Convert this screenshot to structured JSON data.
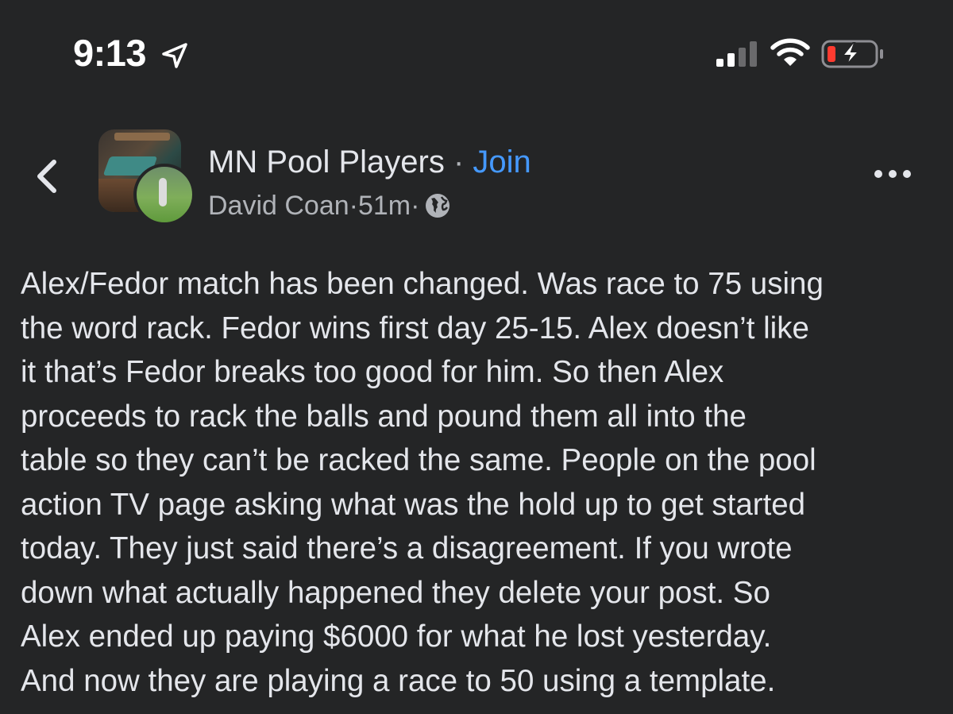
{
  "status_bar": {
    "time": "9:13",
    "location_icon": "location-arrow-icon",
    "signal_icon": "cellular-signal-icon",
    "wifi_icon": "wifi-icon",
    "battery_icon": "battery-charging-icon",
    "battery_level_percent": 15
  },
  "header": {
    "back_icon": "chevron-left-icon",
    "group_name": "MN Pool Players",
    "separator": " · ",
    "join_label": "Join",
    "author": "David Coan",
    "time_ago": "51m",
    "privacy_icon": "globe-icon",
    "more_icon": "more-dots-icon"
  },
  "post": {
    "lines": [
      "Alex/Fedor match has been changed. Was race to 75 using",
      "the word rack. Fedor wins first day 25-15. Alex doesn’t like",
      "it that’s Fedor breaks too good for him. So then Alex",
      "proceeds to rack the balls and pound them all into the",
      "table so they can’t be racked the same. People on the pool",
      "action TV page asking what was the hold up to get started",
      "today. They just said there’s a disagreement. If you wrote",
      "down what actually happened they delete your post. So",
      "Alex ended up paying $6000 for what he lost yesterday.",
      "And now they are playing a race to 50 using a template."
    ]
  },
  "colors": {
    "background": "#242526",
    "text_primary": "#e4e6eb",
    "text_secondary": "#b0b3b8",
    "link": "#4599ff",
    "battery_low": "#ff3b30"
  }
}
